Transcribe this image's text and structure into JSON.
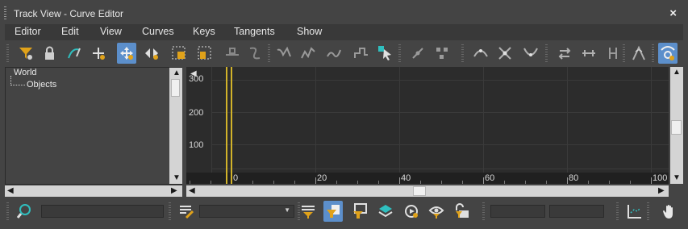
{
  "window": {
    "title": "Track View - Curve Editor",
    "close_glyph": "×"
  },
  "menubar": {
    "items": [
      "Editor",
      "Edit",
      "View",
      "Curves",
      "Keys",
      "Tangents",
      "Show"
    ]
  },
  "colors": {
    "accent": "#5c8fcb",
    "time_slider": "#d2b32a",
    "graph_bg": "#2c2c2c"
  },
  "toolbar": {
    "buttons": [
      {
        "icon": "filter-icon"
      },
      {
        "icon": "lock-selection-icon"
      },
      {
        "icon": "draw-curves-icon"
      },
      {
        "icon": "add-key-icon"
      },
      {
        "icon": "move-keys-icon",
        "active": true
      },
      {
        "icon": "slide-keys-icon"
      },
      {
        "icon": "scale-keys-icon"
      },
      {
        "icon": "scale-values-icon"
      },
      {
        "icon": "reduce-keys-icon"
      },
      {
        "icon": "auto-tangent-icon"
      },
      {
        "icon": "spline-tangent-icon"
      },
      {
        "icon": "fast-tangent-icon"
      },
      {
        "icon": "slow-tangent-icon"
      },
      {
        "icon": "step-tangent-icon"
      },
      {
        "icon": "select-cursor-icon"
      },
      {
        "icon": "linear-tangent-icon"
      },
      {
        "icon": "smooth-tangent-icon"
      },
      {
        "icon": "break-tangents-icon"
      },
      {
        "icon": "unify-tangents-icon"
      },
      {
        "icon": "out-of-range-icon"
      },
      {
        "icon": "snap-frames-icon"
      },
      {
        "icon": "isolate-curve-icon"
      },
      {
        "icon": "show-tangents-icon"
      },
      {
        "icon": "key-stats-icon",
        "active": true
      }
    ]
  },
  "tree": {
    "items": [
      "World",
      "Objects"
    ]
  },
  "graph": {
    "y_ticks": [
      "300",
      "200",
      "100"
    ],
    "x_ticks": [
      "0",
      "20",
      "40",
      "60",
      "80",
      "100"
    ]
  },
  "bottom_toolbar": {
    "buttons": [
      {
        "icon": "zoom-search-icon"
      },
      {
        "icon": "track-list-icon"
      },
      {
        "icon": "filter-selected-icon"
      },
      {
        "icon": "filter-animated-icon",
        "active": true
      },
      {
        "icon": "filter-keyframes-icon"
      },
      {
        "icon": "layers-icon"
      },
      {
        "icon": "show-objects-icon"
      },
      {
        "icon": "visible-filter-icon"
      },
      {
        "icon": "unlocked-filter-icon"
      },
      {
        "icon": "frame-graph-icon"
      },
      {
        "icon": "pan-hand-icon"
      }
    ]
  }
}
